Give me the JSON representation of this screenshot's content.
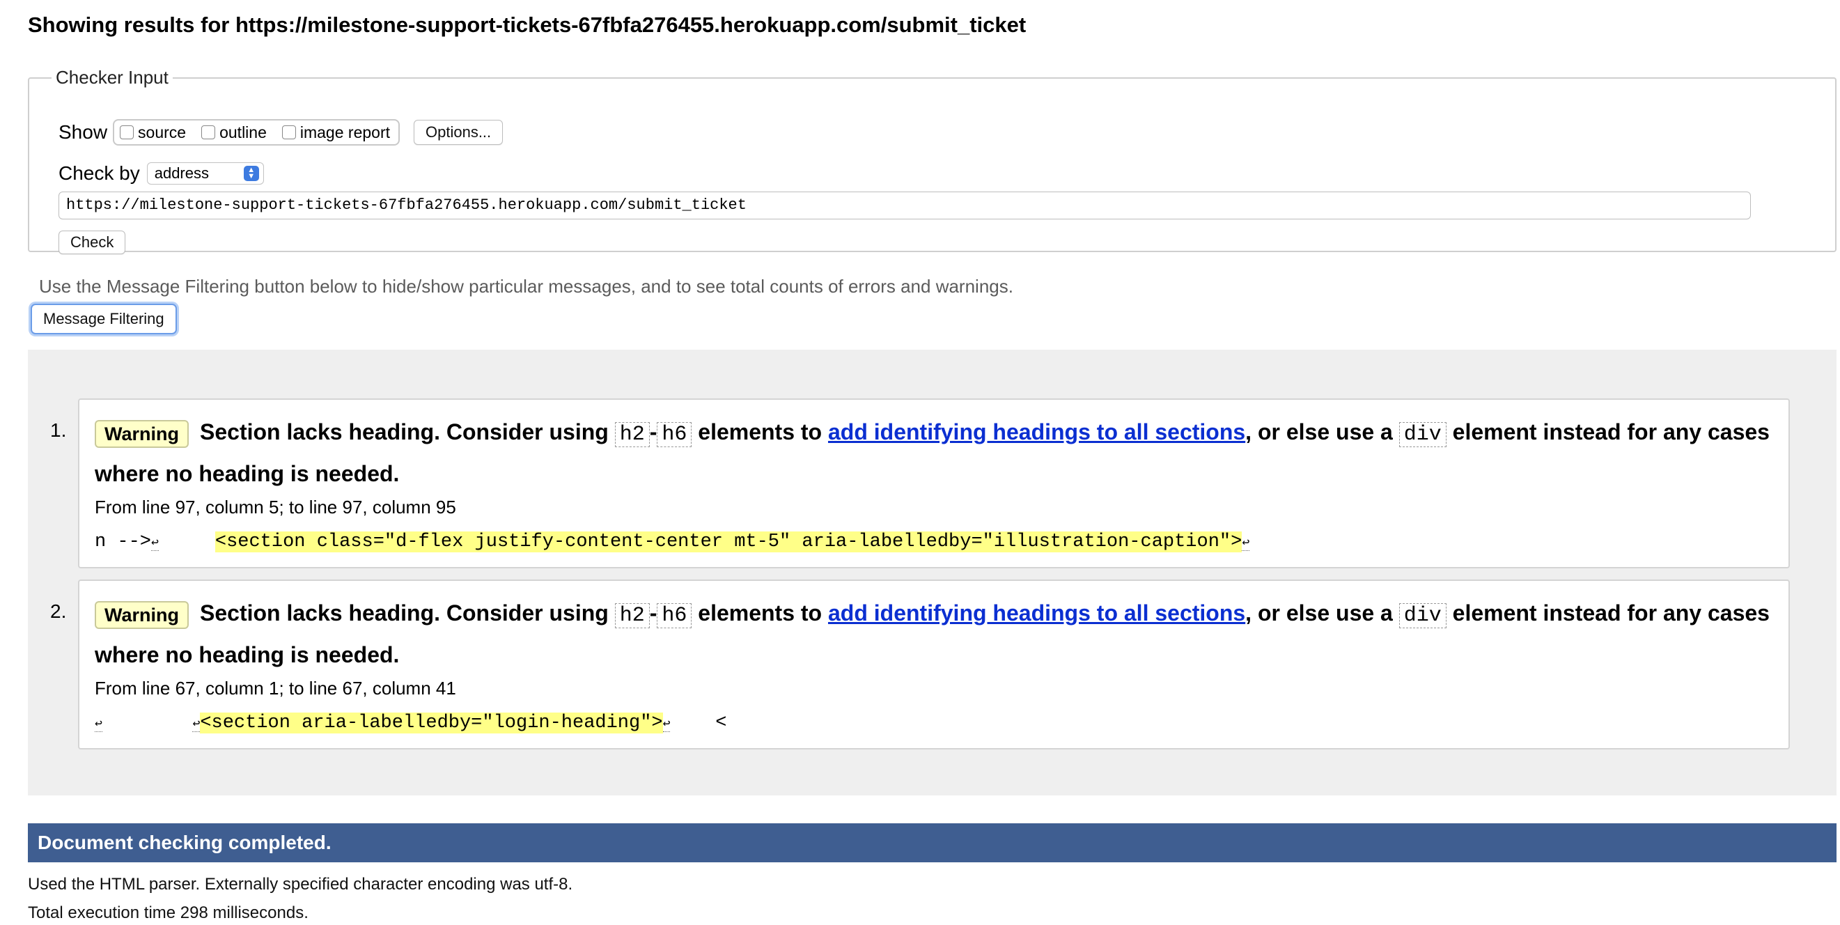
{
  "header": {
    "title": "Showing results for https://milestone-support-tickets-67fbfa276455.herokuapp.com/submit_ticket"
  },
  "checker": {
    "legend": "Checker Input",
    "show_label": "Show",
    "options": [
      {
        "label": "source",
        "checked": false
      },
      {
        "label": "outline",
        "checked": false
      },
      {
        "label": "image report",
        "checked": false
      }
    ],
    "options_button": "Options...",
    "check_by_label": "Check by",
    "check_by_value": "address",
    "url_value": "https://milestone-support-tickets-67fbfa276455.herokuapp.com/submit_ticket",
    "check_button": "Check"
  },
  "filter": {
    "hint": "Use the Message Filtering button below to hide/show particular messages, and to see total counts of errors and warnings.",
    "button": "Message Filtering"
  },
  "messages": [
    {
      "number": "1.",
      "badge": "Warning",
      "title_pre": "Section lacks heading. Consider using",
      "code1": "h2",
      "dash": "-",
      "code2": "h6",
      "title_mid": "elements to",
      "link": "add identifying headings to all sections",
      "title_post": ", or else use a",
      "code3": "div",
      "title_end": "element instead for any cases where no heading is needed.",
      "location": "From line 97, column 5; to line 97, column 95",
      "extract_pre": "n -->",
      "extract_gap": "     ",
      "extract_hl": "<section class=\"d-flex justify-content-center mt-5\" aria-labelledby=\"illustration-caption\">",
      "extract_post": ""
    },
    {
      "number": "2.",
      "badge": "Warning",
      "title_pre": "Section lacks heading. Consider using",
      "code1": "h2",
      "dash": "-",
      "code2": "h6",
      "title_mid": "elements to",
      "link": "add identifying headings to all sections",
      "title_post": ", or else use a",
      "code3": "div",
      "title_end": "element instead for any cases where no heading is needed.",
      "location": "From line 67, column 1; to line 67, column 41",
      "extract_pre": "",
      "extract_gap": "        ",
      "extract_hl": "<section aria-labelledby=\"login-heading\">",
      "extract_post": "    <"
    }
  ],
  "linebreak_glyph": "↩",
  "footer": {
    "completed": "Document checking completed.",
    "parser": "Used the HTML parser. Externally specified character encoding was utf-8.",
    "time": "Total execution time 298 milliseconds."
  },
  "colors": {
    "completed_bar": "#3f5e91",
    "warning_badge": "#ffffc9",
    "highlight": "#ffff88",
    "link": "#0b2fd1"
  }
}
